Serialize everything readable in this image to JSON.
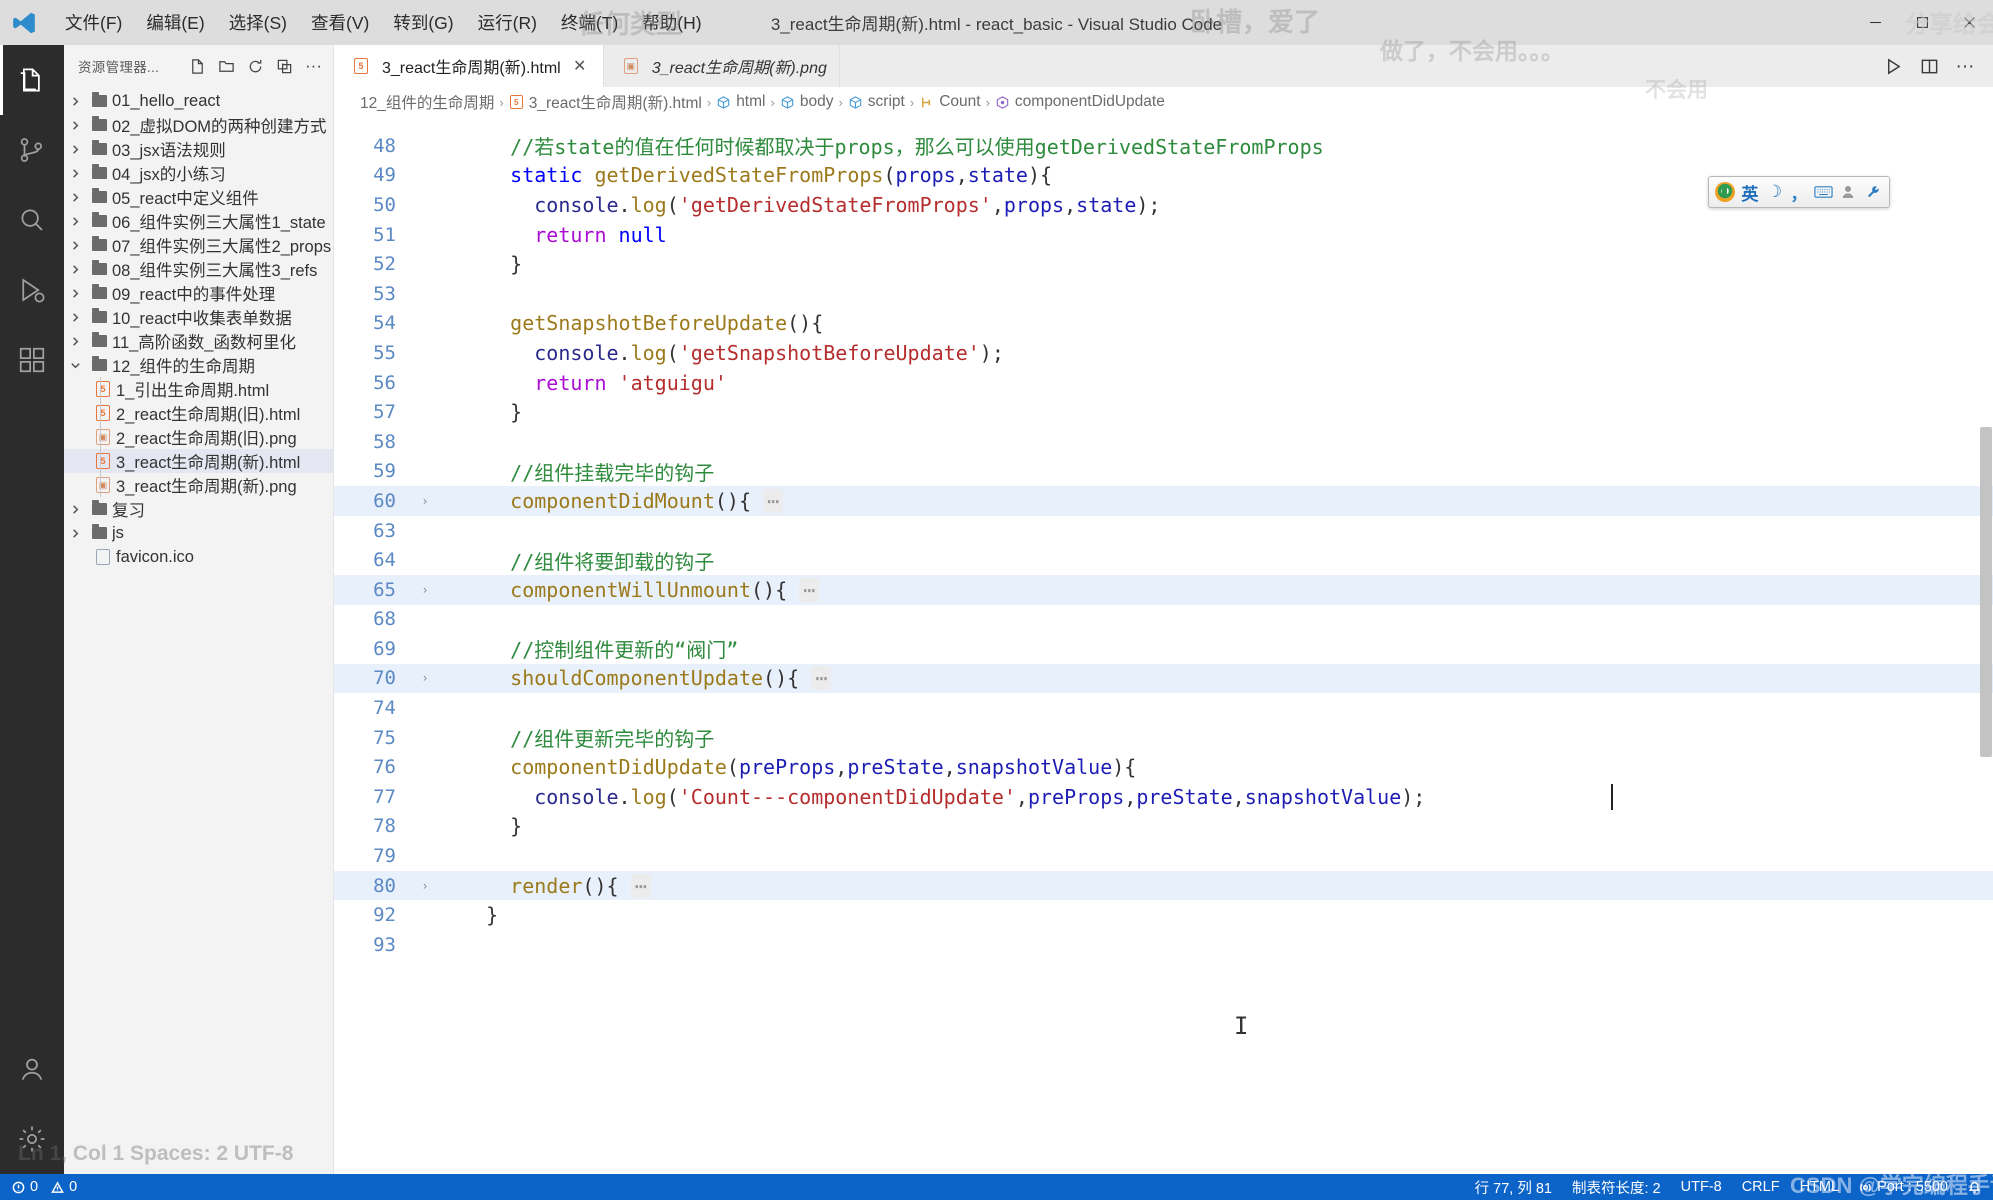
{
  "window": {
    "title": "3_react生命周期(新).html - react_basic - Visual Studio Code",
    "minimize": "—",
    "maximize": "▢",
    "close": "✕"
  },
  "menubar": {
    "logo": "vscode-logo",
    "items": [
      {
        "label": "文件(F)"
      },
      {
        "label": "编辑(E)"
      },
      {
        "label": "选择(S)"
      },
      {
        "label": "查看(V)"
      },
      {
        "label": "转到(G)"
      },
      {
        "label": "运行(R)"
      },
      {
        "label": "终端(T)"
      },
      {
        "label": "帮助(H)"
      }
    ]
  },
  "watermarks": [
    {
      "text": "任何类型"
    },
    {
      "text": "卧槽，爱了"
    },
    {
      "text": "做了，不会用。。。"
    },
    {
      "text": "分享给会员啊"
    },
    {
      "text": "不会用"
    },
    {
      "text": "CSDN @学完编程手记"
    },
    {
      "text": "Ln 1, Col 1  Spaces: 2  UTF-8"
    }
  ],
  "activitybar": {
    "items": [
      {
        "name": "explorer",
        "icon": "files-icon",
        "active": true
      },
      {
        "name": "source-control",
        "icon": "source-control-icon",
        "active": false
      },
      {
        "name": "search",
        "icon": "search-icon",
        "active": false
      },
      {
        "name": "run-debug",
        "icon": "run-debug-icon",
        "active": false
      },
      {
        "name": "extensions",
        "icon": "extensions-icon",
        "active": false
      }
    ],
    "bottom": [
      {
        "name": "accounts",
        "icon": "account-icon"
      },
      {
        "name": "settings",
        "icon": "gear-icon"
      }
    ]
  },
  "sidebar": {
    "title": "资源管理器...",
    "actions": [
      {
        "name": "new-file",
        "icon": "new-file-icon"
      },
      {
        "name": "new-folder",
        "icon": "new-folder-icon"
      },
      {
        "name": "refresh-explorer",
        "icon": "refresh-icon"
      },
      {
        "name": "collapse-folders",
        "icon": "collapse-all-icon"
      },
      {
        "name": "views-and-more-actions",
        "icon": "ellipsis-icon"
      }
    ],
    "tree": [
      {
        "label": "01_hello_react",
        "type": "folder",
        "expanded": false,
        "indent": 0
      },
      {
        "label": "02_虚拟DOM的两种创建方式",
        "type": "folder",
        "expanded": false,
        "indent": 0
      },
      {
        "label": "03_jsx语法规则",
        "type": "folder",
        "expanded": false,
        "indent": 0
      },
      {
        "label": "04_jsx的小练习",
        "type": "folder",
        "expanded": false,
        "indent": 0
      },
      {
        "label": "05_react中定义组件",
        "type": "folder",
        "expanded": false,
        "indent": 0
      },
      {
        "label": "06_组件实例三大属性1_state",
        "type": "folder",
        "expanded": false,
        "indent": 0
      },
      {
        "label": "07_组件实例三大属性2_props",
        "type": "folder",
        "expanded": false,
        "indent": 0
      },
      {
        "label": "08_组件实例三大属性3_refs",
        "type": "folder",
        "expanded": false,
        "indent": 0
      },
      {
        "label": "09_react中的事件处理",
        "type": "folder",
        "expanded": false,
        "indent": 0
      },
      {
        "label": "10_react中收集表单数据",
        "type": "folder",
        "expanded": false,
        "indent": 0
      },
      {
        "label": "11_高阶函数_函数柯里化",
        "type": "folder",
        "expanded": false,
        "indent": 0
      },
      {
        "label": "12_组件的生命周期",
        "type": "folder",
        "expanded": true,
        "indent": 0
      },
      {
        "label": "1_引出生命周期.html",
        "type": "html",
        "indent": 1
      },
      {
        "label": "2_react生命周期(旧).html",
        "type": "html",
        "indent": 1
      },
      {
        "label": "2_react生命周期(旧).png",
        "type": "png",
        "indent": 1
      },
      {
        "label": "3_react生命周期(新).html",
        "type": "html",
        "indent": 1,
        "selected": true
      },
      {
        "label": "3_react生命周期(新).png",
        "type": "png",
        "indent": 1
      },
      {
        "label": "复习",
        "type": "folder",
        "expanded": false,
        "indent": 0
      },
      {
        "label": "js",
        "type": "folder",
        "expanded": false,
        "indent": 0
      },
      {
        "label": "favicon.ico",
        "type": "ico",
        "indent": 1
      }
    ]
  },
  "tabs": {
    "items": [
      {
        "label": "3_react生命周期(新).html",
        "icon": "html-file-icon",
        "active": true,
        "preview": false,
        "close": "✕"
      },
      {
        "label": "3_react生命周期(新).png",
        "icon": "png-file-icon",
        "active": false,
        "preview": true
      }
    ],
    "actions": [
      {
        "name": "run-code",
        "icon": "play-icon"
      },
      {
        "name": "split-editor",
        "icon": "split-editor-icon"
      },
      {
        "name": "more-actions",
        "icon": "ellipsis-icon"
      }
    ]
  },
  "breadcrumb": {
    "items": [
      {
        "label": "12_组件的生命周期",
        "icon": ""
      },
      {
        "label": "3_react生命周期(新).html",
        "icon": "html-file-icon"
      },
      {
        "label": "html",
        "icon": "symbol-field-icon"
      },
      {
        "label": "body",
        "icon": "symbol-field-icon"
      },
      {
        "label": "script",
        "icon": "symbol-field-icon"
      },
      {
        "label": "Count",
        "icon": "symbol-class-icon"
      },
      {
        "label": "componentDidUpdate",
        "icon": "symbol-method-icon"
      }
    ],
    "separator": "›"
  },
  "code": {
    "first_partial_line": "47",
    "lines": [
      {
        "no": "48",
        "indent": 2,
        "highlight": false,
        "fold": false,
        "tokens": [
          {
            "t": "//若state的值在任何时候都取决于props，那么可以使用getDerivedStateFromProps",
            "c": "t-com"
          }
        ]
      },
      {
        "no": "49",
        "indent": 2,
        "highlight": false,
        "fold": false,
        "tokens": [
          {
            "t": "static ",
            "c": "t-kw"
          },
          {
            "t": "getDerivedStateFromProps",
            "c": "t-fn"
          },
          {
            "t": "(",
            "c": "t-pun"
          },
          {
            "t": "props",
            "c": "t-var"
          },
          {
            "t": ",",
            "c": "t-pun"
          },
          {
            "t": "state",
            "c": "t-var"
          },
          {
            "t": "){",
            "c": "t-pun"
          }
        ]
      },
      {
        "no": "50",
        "indent": 3,
        "highlight": false,
        "fold": false,
        "tokens": [
          {
            "t": "console",
            "c": "t-prop"
          },
          {
            "t": ".",
            "c": "t-pun"
          },
          {
            "t": "log",
            "c": "t-fn"
          },
          {
            "t": "(",
            "c": "t-pun"
          },
          {
            "t": "'getDerivedStateFromProps'",
            "c": "t-str"
          },
          {
            "t": ",",
            "c": "t-pun"
          },
          {
            "t": "props",
            "c": "t-var"
          },
          {
            "t": ",",
            "c": "t-pun"
          },
          {
            "t": "state",
            "c": "t-var"
          },
          {
            "t": ");",
            "c": "t-pun"
          }
        ]
      },
      {
        "no": "51",
        "indent": 3,
        "highlight": false,
        "fold": false,
        "tokens": [
          {
            "t": "return ",
            "c": "t-kw2"
          },
          {
            "t": "null",
            "c": "t-kw"
          }
        ]
      },
      {
        "no": "52",
        "indent": 2,
        "highlight": false,
        "fold": false,
        "tokens": [
          {
            "t": "}",
            "c": "t-pun"
          }
        ]
      },
      {
        "no": "53",
        "indent": 0,
        "highlight": false,
        "fold": false,
        "tokens": []
      },
      {
        "no": "54",
        "indent": 2,
        "highlight": false,
        "fold": false,
        "tokens": [
          {
            "t": "getSnapshotBeforeUpdate",
            "c": "t-fn"
          },
          {
            "t": "(){",
            "c": "t-pun"
          }
        ]
      },
      {
        "no": "55",
        "indent": 3,
        "highlight": false,
        "fold": false,
        "tokens": [
          {
            "t": "console",
            "c": "t-prop"
          },
          {
            "t": ".",
            "c": "t-pun"
          },
          {
            "t": "log",
            "c": "t-fn"
          },
          {
            "t": "(",
            "c": "t-pun"
          },
          {
            "t": "'getSnapshotBeforeUpdate'",
            "c": "t-str"
          },
          {
            "t": ");",
            "c": "t-pun"
          }
        ]
      },
      {
        "no": "56",
        "indent": 3,
        "highlight": false,
        "fold": false,
        "tokens": [
          {
            "t": "return ",
            "c": "t-kw2"
          },
          {
            "t": "'atguigu'",
            "c": "t-str"
          }
        ]
      },
      {
        "no": "57",
        "indent": 2,
        "highlight": false,
        "fold": false,
        "tokens": [
          {
            "t": "}",
            "c": "t-pun"
          }
        ]
      },
      {
        "no": "58",
        "indent": 0,
        "highlight": false,
        "fold": false,
        "tokens": []
      },
      {
        "no": "59",
        "indent": 2,
        "highlight": false,
        "fold": false,
        "tokens": [
          {
            "t": "//组件挂载完毕的钩子",
            "c": "t-com"
          }
        ]
      },
      {
        "no": "60",
        "indent": 2,
        "highlight": true,
        "fold": true,
        "tokens": [
          {
            "t": "componentDidMount",
            "c": "t-fn"
          },
          {
            "t": "(){ ",
            "c": "t-pun"
          },
          {
            "t": "⋯",
            "c": "t-fold"
          }
        ]
      },
      {
        "no": "63",
        "indent": 0,
        "highlight": false,
        "fold": false,
        "tokens": []
      },
      {
        "no": "64",
        "indent": 2,
        "highlight": false,
        "fold": false,
        "tokens": [
          {
            "t": "//组件将要卸载的钩子",
            "c": "t-com"
          }
        ]
      },
      {
        "no": "65",
        "indent": 2,
        "highlight": true,
        "fold": true,
        "tokens": [
          {
            "t": "componentWillUnmount",
            "c": "t-fn"
          },
          {
            "t": "(){ ",
            "c": "t-pun"
          },
          {
            "t": "⋯",
            "c": "t-fold"
          }
        ]
      },
      {
        "no": "68",
        "indent": 0,
        "highlight": false,
        "fold": false,
        "tokens": []
      },
      {
        "no": "69",
        "indent": 2,
        "highlight": false,
        "fold": false,
        "tokens": [
          {
            "t": "//控制组件更新的“阀门”",
            "c": "t-com"
          }
        ]
      },
      {
        "no": "70",
        "indent": 2,
        "highlight": true,
        "fold": true,
        "tokens": [
          {
            "t": "shouldComponentUpdate",
            "c": "t-fn"
          },
          {
            "t": "(){ ",
            "c": "t-pun"
          },
          {
            "t": "⋯",
            "c": "t-fold"
          }
        ]
      },
      {
        "no": "74",
        "indent": 0,
        "highlight": false,
        "fold": false,
        "tokens": []
      },
      {
        "no": "75",
        "indent": 2,
        "highlight": false,
        "fold": false,
        "tokens": [
          {
            "t": "//组件更新完毕的钩子",
            "c": "t-com"
          }
        ]
      },
      {
        "no": "76",
        "indent": 2,
        "highlight": false,
        "fold": false,
        "tokens": [
          {
            "t": "componentDidUpdate",
            "c": "t-fn"
          },
          {
            "t": "(",
            "c": "t-pun"
          },
          {
            "t": "preProps",
            "c": "t-var"
          },
          {
            "t": ",",
            "c": "t-pun"
          },
          {
            "t": "preState",
            "c": "t-var"
          },
          {
            "t": ",",
            "c": "t-pun"
          },
          {
            "t": "snapshotValue",
            "c": "t-var"
          },
          {
            "t": "){",
            "c": "t-pun"
          }
        ]
      },
      {
        "no": "77",
        "indent": 3,
        "highlight": false,
        "fold": false,
        "caret": true,
        "tokens": [
          {
            "t": "console",
            "c": "t-prop"
          },
          {
            "t": ".",
            "c": "t-pun"
          },
          {
            "t": "log",
            "c": "t-fn"
          },
          {
            "t": "(",
            "c": "t-pun"
          },
          {
            "t": "'Count---componentDidUpdate'",
            "c": "t-str"
          },
          {
            "t": ",",
            "c": "t-pun"
          },
          {
            "t": "preProps",
            "c": "t-var"
          },
          {
            "t": ",",
            "c": "t-pun"
          },
          {
            "t": "preState",
            "c": "t-var"
          },
          {
            "t": ",",
            "c": "t-pun"
          },
          {
            "t": "snapshotValue",
            "c": "t-var"
          },
          {
            "t": ");",
            "c": "t-pun"
          }
        ]
      },
      {
        "no": "78",
        "indent": 2,
        "highlight": false,
        "fold": false,
        "tokens": [
          {
            "t": "}",
            "c": "t-pun"
          }
        ]
      },
      {
        "no": "79",
        "indent": 0,
        "highlight": false,
        "fold": false,
        "tokens": []
      },
      {
        "no": "80",
        "indent": 2,
        "highlight": true,
        "fold": true,
        "tokens": [
          {
            "t": "render",
            "c": "t-fn"
          },
          {
            "t": "(){ ",
            "c": "t-pun"
          },
          {
            "t": "⋯",
            "c": "t-fold"
          }
        ]
      },
      {
        "no": "92",
        "indent": 1,
        "highlight": false,
        "fold": false,
        "tokens": [
          {
            "t": "}",
            "c": "t-pun"
          }
        ]
      },
      {
        "no": "93",
        "indent": 0,
        "highlight": false,
        "fold": false,
        "tokens": []
      }
    ]
  },
  "statusbar": {
    "left": [
      {
        "label": "0",
        "icon": "error-icon",
        "name": "problems-errors"
      },
      {
        "label": "0",
        "icon": "warning-icon",
        "name": "problems-warnings"
      }
    ],
    "right": [
      {
        "label": "行 77, 列 81",
        "name": "editor-position"
      },
      {
        "label": "制表符长度: 2",
        "name": "editor-indentation"
      },
      {
        "label": "UTF-8",
        "name": "editor-encoding"
      },
      {
        "label": "CRLF",
        "name": "editor-eol"
      },
      {
        "label": "HTML",
        "name": "editor-language"
      },
      {
        "label": "Port : 5500",
        "icon": "broadcast-icon",
        "name": "live-server-port"
      },
      {
        "label": "",
        "icon": "bell-icon",
        "name": "notifications"
      }
    ]
  },
  "ime": {
    "items": [
      {
        "name": "sogou-logo-icon",
        "glyph": ""
      },
      {
        "name": "input-mode-english-icon",
        "glyph": "英"
      },
      {
        "name": "moon-icon",
        "glyph": "☽"
      },
      {
        "name": "punctuation-icon",
        "glyph": "，"
      },
      {
        "name": "soft-keyboard-icon",
        "glyph": ""
      },
      {
        "name": "user-icon",
        "glyph": ""
      },
      {
        "name": "toolbox-icon",
        "glyph": ""
      }
    ]
  }
}
